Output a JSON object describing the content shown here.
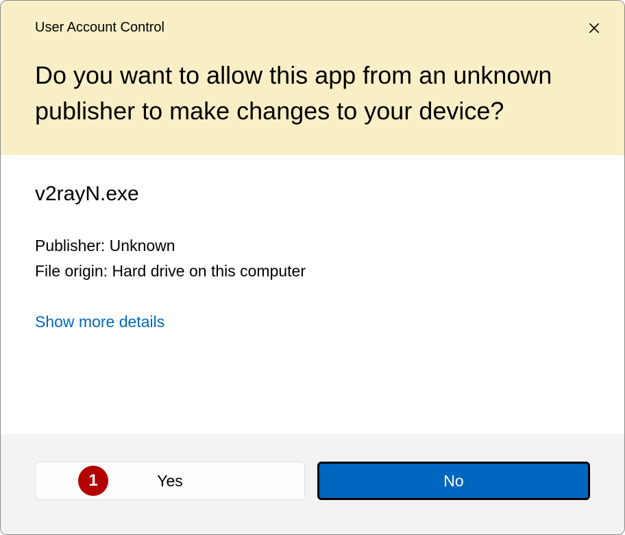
{
  "dialog": {
    "title": "User Account Control",
    "question": "Do you want to allow this app from an unknown publisher to make changes to your device?"
  },
  "app": {
    "name": "v2rayN.exe",
    "publisher_label": "Publisher: Unknown",
    "origin_label": "File origin: Hard drive on this computer"
  },
  "links": {
    "show_more": "Show more details"
  },
  "buttons": {
    "yes": "Yes",
    "no": "No",
    "badge_number": "1"
  }
}
